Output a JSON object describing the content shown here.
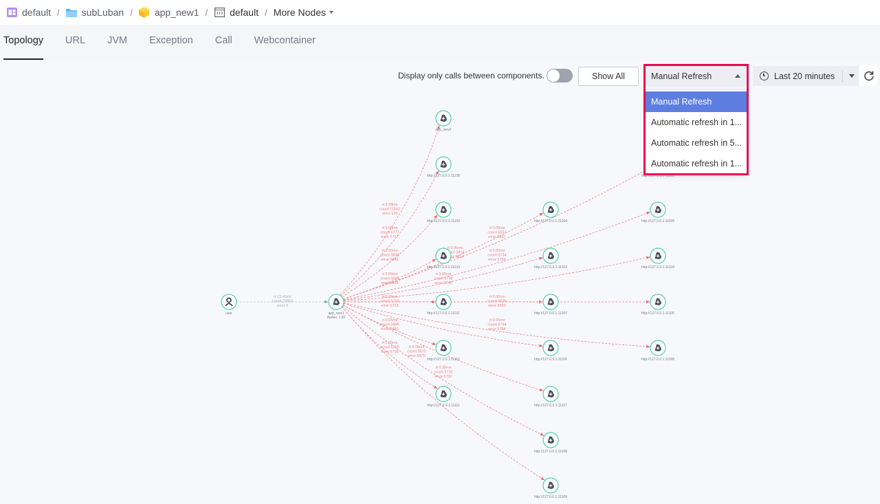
{
  "breadcrumb": {
    "items": [
      {
        "label": "default",
        "icon": "workspace-icon"
      },
      {
        "label": "subLuban",
        "icon": "folder-icon"
      },
      {
        "label": "app_new1",
        "icon": "app-cube-icon"
      },
      {
        "label": "default",
        "icon": "code-env-icon"
      }
    ],
    "separator": "/",
    "more_label": "More Nodes"
  },
  "tabs": [
    {
      "label": "Topology",
      "active": true
    },
    {
      "label": "URL",
      "active": false
    },
    {
      "label": "JVM",
      "active": false
    },
    {
      "label": "Exception",
      "active": false
    },
    {
      "label": "Call",
      "active": false
    },
    {
      "label": "Webcontainer",
      "active": false
    }
  ],
  "toolbar": {
    "toggle_label": "Display only calls between components.",
    "toggle_on": false,
    "show_all_label": "Show All",
    "refresh_select": {
      "value": "Manual Refresh",
      "options": [
        {
          "label": "Manual Refresh",
          "selected": true
        },
        {
          "label": "Automatic refresh in 1...",
          "selected": false
        },
        {
          "label": "Automatic refresh in 5...",
          "selected": false
        },
        {
          "label": "Automatic refresh in 1...",
          "selected": false
        }
      ]
    },
    "time_range": "Last 20 minutes"
  },
  "colors": {
    "node_border": "#4fd1a5",
    "node_icon": "#4a4f5c",
    "edge_error": "#f08080",
    "edge_normal": "#b8bcc6",
    "selected_option": "#5d7ee0",
    "highlight": "#e8094f"
  },
  "topology": {
    "nodes": [
      {
        "id": "user",
        "label": "user",
        "type": "user"
      },
      {
        "id": "app_new1",
        "label": "app_new1",
        "sublabel": "Apdex: 1.00",
        "type": "app"
      },
      {
        "id": "app_new2",
        "label": "app_new2",
        "type": "app"
      },
      {
        "id": "n11108",
        "label": "http://127.0.0.1:11108",
        "type": "app"
      },
      {
        "id": "n11109",
        "label": "http://127.0.0.1:11109",
        "type": "app"
      },
      {
        "id": "n11010",
        "label": "http://127.0.0.1:11010",
        "type": "app"
      },
      {
        "id": "n11011",
        "label": "http://127.0.0.1:11011",
        "type": "app"
      },
      {
        "id": "n11110",
        "label": "http://127.0.0.1:11110",
        "type": "app"
      },
      {
        "id": "n11111",
        "label": "http://127.0.0.1:11111",
        "type": "app"
      },
      {
        "id": "n11004",
        "label": "http://127.0.0.1:11004",
        "type": "app"
      },
      {
        "id": "n11103",
        "label": "http://127.0.0.1:11103",
        "type": "app"
      },
      {
        "id": "n11007",
        "label": "http://127.0.0.1:11007",
        "type": "app"
      },
      {
        "id": "n11106",
        "label": "http://127.0.0.1:11106",
        "type": "app"
      },
      {
        "id": "n11107",
        "label": "http://127.0.0.1:11107",
        "type": "app"
      },
      {
        "id": "n11008",
        "label": "http://127.0.0.1:11008",
        "type": "app"
      },
      {
        "id": "n11009",
        "label": "http://127.0.0.1:11009",
        "type": "app"
      },
      {
        "id": "n11102",
        "label": "http://127.0.0.1:11102",
        "type": "app"
      },
      {
        "id": "n11005",
        "label": "http://127.0.0.1:11005",
        "type": "app"
      },
      {
        "id": "n11104",
        "label": "http://127.0.0.1:11104",
        "type": "app"
      },
      {
        "id": "n11105",
        "label": "http://127.0.0.1:11105",
        "type": "app"
      },
      {
        "id": "n11006",
        "label": "http://127.0.0.1:11006",
        "type": "app"
      }
    ],
    "edges": [
      {
        "from": "user",
        "to": "app_new1",
        "rt": "rt 13.49ms",
        "count": "count 22852",
        "error": "error 0",
        "status": "normal"
      },
      {
        "from": "app_new1",
        "to": "app_new2",
        "rt": "rt 9.29ms",
        "count": "count 11553",
        "error": "error 139",
        "status": "error"
      },
      {
        "from": "app_new1",
        "to": "n11108",
        "rt": "rt 0.05ms",
        "count": "count 5777",
        "error": "error 5777",
        "status": "error"
      },
      {
        "from": "app_new1",
        "to": "n11109",
        "rt": "rt 0.05ms",
        "count": "count 5845",
        "error": "error 5845",
        "status": "error"
      },
      {
        "from": "app_new1",
        "to": "n11010",
        "rt": "rt 0.05ms",
        "count": "count 5885",
        "error": "error 5885",
        "status": "error"
      },
      {
        "from": "app_new1",
        "to": "n11011",
        "rt": "rt 0.05ms",
        "count": "count 5733",
        "error": "error 5733",
        "status": "error"
      },
      {
        "from": "app_new1",
        "to": "n11110",
        "rt": "rt 0.05ms",
        "count": "count 5885",
        "error": "error 5885",
        "status": "error"
      },
      {
        "from": "app_new1",
        "to": "n11111",
        "rt": "rt 0.05ms",
        "count": "count 5728",
        "error": "error 5728",
        "status": "error"
      },
      {
        "from": "app_new1",
        "to": "n11004",
        "rt": "rt 0.05ms",
        "count": "count 5837",
        "error": "error 5837",
        "status": "error"
      },
      {
        "from": "app_new1",
        "to": "n11103",
        "rt": "rt 0.05ms",
        "count": "count 5734",
        "error": "error 5734",
        "status": "error"
      },
      {
        "from": "app_new1",
        "to": "n11007",
        "rt": "rt 0.05ms",
        "count": "count 5830",
        "error": "error 5830",
        "status": "error"
      },
      {
        "from": "app_new1",
        "to": "n11106",
        "rt": "rt 0.05ms",
        "count": "count 5784",
        "error": "error 5784",
        "status": "error"
      },
      {
        "from": "app_new1",
        "to": "n11107",
        "rt": "rt 0.05ms",
        "count": "count 5732",
        "error": "error 5732",
        "status": "error"
      },
      {
        "from": "app_new1",
        "to": "n11008",
        "rt": "rt 0.05ms",
        "count": "count 5870",
        "error": "error 5870",
        "status": "error"
      },
      {
        "from": "app_new1",
        "to": "n11009",
        "rt": "",
        "count": "",
        "error": "",
        "status": "error"
      },
      {
        "from": "app_new1",
        "to": "n11102",
        "rt": "rt 0.06ms",
        "count": "count 5814",
        "error": "error 5814",
        "status": "error"
      },
      {
        "from": "app_new1",
        "to": "n11005",
        "rt": "",
        "count": "",
        "error": "",
        "status": "error"
      },
      {
        "from": "app_new1",
        "to": "n11104",
        "rt": "rt 0.05ms",
        "count": "count 5748",
        "error": "error 5748",
        "status": "error"
      },
      {
        "from": "app_new1",
        "to": "n11105",
        "rt": "",
        "count": "",
        "error": "",
        "status": "error"
      },
      {
        "from": "app_new1",
        "to": "n11006",
        "rt": "",
        "count": "",
        "error": "",
        "status": "error"
      }
    ]
  }
}
